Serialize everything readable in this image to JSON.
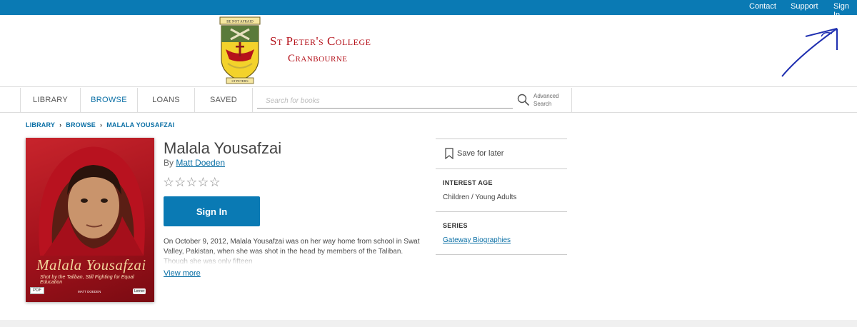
{
  "topbar": {
    "contact": "Contact",
    "support": "Support",
    "sign_in": "Sign In"
  },
  "header": {
    "college_line1": "St Peter's College",
    "college_line2": "Cranbourne",
    "crest_motto": "BE NOT AFRAID",
    "crest_banner": "ST PETER'S"
  },
  "nav": {
    "tabs": [
      "LIBRARY",
      "BROWSE",
      "LOANS",
      "SAVED"
    ],
    "active_tab": "BROWSE",
    "search_placeholder": "Search for books",
    "advanced_line1": "Advanced",
    "advanced_line2": "Search"
  },
  "breadcrumb": [
    "LIBRARY",
    "BROWSE",
    "MALALA YOUSAFZAI"
  ],
  "book": {
    "title": "Malala Yousafzai",
    "by_label": "By",
    "author": "Matt Doeden",
    "rating": 0,
    "rating_max": 5,
    "sign_in_button": "Sign In",
    "description": "On October 9, 2012, Malala Yousafzai was on her way home from school in Swat Valley, Pakistan, when she was shot in the head by members of the Taliban. Though she was only fifteen",
    "view_more": "View more",
    "cover": {
      "title": "Malala Yousafzai",
      "subtitle": "Shot by the Taliban, Still Fighting for Equal Education",
      "author": "MATT DOEDEN",
      "format_badge": "PDF",
      "publisher": "Lerner"
    }
  },
  "sidebar": {
    "save_for_later": "Save for later",
    "interest_age_heading": "INTEREST AGE",
    "interest_age_value": "Children / Young Adults",
    "series_heading": "SERIES",
    "series_value": "Gateway Biographies"
  },
  "colors": {
    "brand_blue": "#0a7ab4",
    "link_blue": "#0a6fa5",
    "college_red": "#b5121b"
  }
}
